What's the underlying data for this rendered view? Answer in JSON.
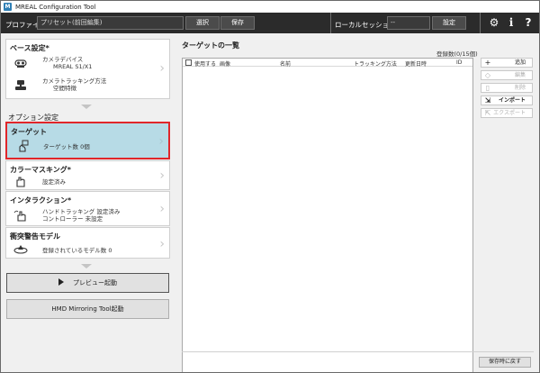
{
  "window": {
    "title": "MREAL Configuration Tool"
  },
  "toolbar": {
    "profile_label": "プロファイル",
    "profile_value": "プリセット(前回編集)",
    "select_label": "選択",
    "save_label": "保存",
    "session_label": "ローカルセッション",
    "session_value": "--",
    "settings_label": "設定"
  },
  "left": {
    "base_title": "ベース設定*",
    "camera_device_label": "カメラデバイス",
    "camera_device_value": "MREAL S1/X1",
    "camera_tracking_label": "カメラトラッキング方法",
    "camera_tracking_value": "空間特徴",
    "options_title": "オプション設定",
    "target_title": "ターゲット",
    "target_count": "ターゲット数 0個",
    "color_masking_title": "カラーマスキング*",
    "color_masking_status": "設定済み",
    "interaction_title": "インタラクション*",
    "interaction_hand": "ハンドトラッキング 設定済み",
    "interaction_controller": "コントローラー 未設定",
    "collision_title": "衝突警告モデル",
    "collision_status": "登録されているモデル数 0",
    "preview_button": "プレビュー起動",
    "hmd_button": "HMD Mirroring Tool起動"
  },
  "main": {
    "title": "ターゲットの一覧",
    "count": "登録数(0/15個)",
    "columns": [
      "使用する",
      "画像",
      "名前",
      "トラッキング方法",
      "更新日時",
      "ID"
    ],
    "buttons": {
      "add": "追加",
      "edit": "編集",
      "delete": "削除",
      "import": "インポート",
      "export": "エクスポート"
    },
    "restore_button": "保存時に戻す"
  },
  "colors": {
    "toolbar_bg": "#2b2b2b",
    "selected_card_bg": "#b7dbe6",
    "highlight_border": "#e0262a"
  }
}
